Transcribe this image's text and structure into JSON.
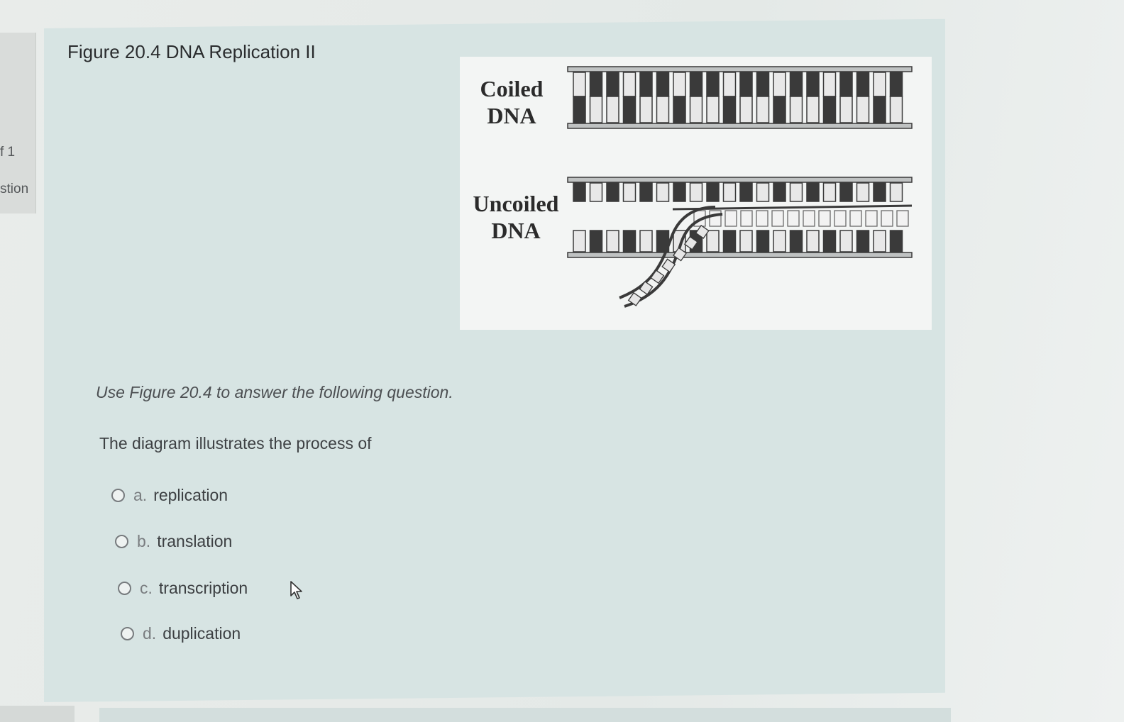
{
  "sidebar": {
    "page_fragment": "f 1",
    "label_fragment": "stion"
  },
  "figure": {
    "title": "Figure 20.4 DNA Replication II",
    "coiled_label_line1": "Coiled",
    "coiled_label_line2": "DNA",
    "uncoiled_label_line1": "Uncoiled",
    "uncoiled_label_line2": "DNA"
  },
  "question": {
    "instructions": "Use Figure 20.4 to answer the following question.",
    "prompt": "The diagram illustrates the process of",
    "options": [
      {
        "letter": "a.",
        "text": "replication"
      },
      {
        "letter": "b.",
        "text": "translation"
      },
      {
        "letter": "c.",
        "text": "transcription"
      },
      {
        "letter": "d.",
        "text": "duplication"
      }
    ]
  },
  "colors": {
    "panel": "#d7e4e3",
    "figure_bg": "#f3f5f4",
    "dna_dark": "#3a3a3a"
  }
}
